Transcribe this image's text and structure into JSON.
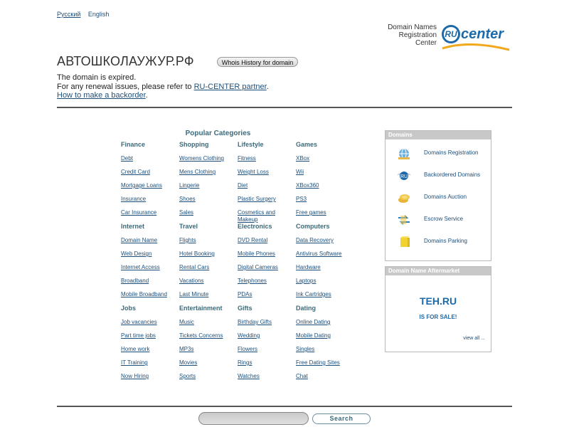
{
  "languages": {
    "russian": "Русский",
    "english": "English"
  },
  "ru_center": {
    "lines": [
      "Domain Names",
      "Registration",
      "Center"
    ],
    "logo_ru": "RU",
    "logo_center": "center"
  },
  "domain": {
    "name": "АВТОШКОЛАУЖУР.РФ",
    "whois_button": "Whois History for domain"
  },
  "expired": {
    "line1": "The domain is expired.",
    "line2_prefix": "For any renewal issues, please refer to ",
    "line2_link": "RU-CENTER partner",
    "line2_suffix": ".",
    "line3_link": "How to make a backorder",
    "line3_suffix": "."
  },
  "categories_title": "Popular Categories",
  "categories": [
    {
      "name": "Finance",
      "links": [
        "Debt",
        "Credit Card",
        "Mortgage Loans",
        "Insurance",
        "Car Insurance"
      ]
    },
    {
      "name": "Shopping",
      "links": [
        "Womens Clothing",
        "Mens Clothing",
        "Lingerie",
        "Shoes",
        "Sales"
      ]
    },
    {
      "name": "Lifestyle",
      "links": [
        "Fitness",
        "Weight Loss",
        "Diet",
        "Plastic Surgery",
        "Cosmetics and Makeup"
      ]
    },
    {
      "name": "Games",
      "links": [
        "XBox",
        "Wii",
        "XBox360",
        "PS3",
        "Free games"
      ]
    },
    {
      "name": "Internet",
      "links": [
        "Domain Name",
        "Web Design",
        "Internet Access",
        "Broadband",
        "Mobile Broadband"
      ]
    },
    {
      "name": "Travel",
      "links": [
        "Flights",
        "Hotel Booking",
        "Rental Cars",
        "Vacations",
        "Last Minute"
      ]
    },
    {
      "name": "Electronics",
      "links": [
        "DVD Rental",
        "Mobile Phones",
        "Digital Cameras",
        "Telephones",
        "PDAs"
      ]
    },
    {
      "name": "Computers",
      "links": [
        "Data Recovery",
        "Antivirus Software",
        "Hardware",
        "Laptops",
        "Ink Cartridges"
      ]
    },
    {
      "name": "Jobs",
      "links": [
        "Job vacancies",
        "Part time jobs",
        "Home work",
        "IT Training",
        "Now Hiring"
      ]
    },
    {
      "name": "Entertainment",
      "links": [
        "Music",
        "Tickets Concerns",
        "MP3s",
        "Movies",
        "Sports"
      ]
    },
    {
      "name": "Gifts",
      "links": [
        "Birthday Gifts",
        "Wedding",
        "Flowers",
        "Rings",
        "Watches"
      ]
    },
    {
      "name": "Dating",
      "links": [
        "Online Dating",
        "Mobile Dating",
        "Singles",
        "Free Dating Sites",
        "Chat"
      ]
    }
  ],
  "domains_box": {
    "title": "Domains",
    "items": [
      {
        "label": "Domains Registration",
        "icon": "globe-icon"
      },
      {
        "label": "Backordered Domains",
        "icon": "ru-wings-icon"
      },
      {
        "label": "Domains Auction",
        "icon": "coins-icon"
      },
      {
        "label": "Escrow Service",
        "icon": "exchange-icon"
      },
      {
        "label": "Domains Parking",
        "icon": "parking-icon"
      }
    ]
  },
  "aftermarket_box": {
    "title": "Domain Name Aftermarket",
    "domain": "TEH.RU",
    "status": "IS FOR SALE!",
    "view_all": "view all ..."
  },
  "search": {
    "placeholder": "",
    "button": "Search"
  },
  "colors": {
    "link": "#1e4f7a",
    "heading": "#3b6b7b",
    "box_header": "#c8c8c8",
    "logo_blue": "#1e6aa8",
    "logo_orange": "#f2a81d"
  }
}
